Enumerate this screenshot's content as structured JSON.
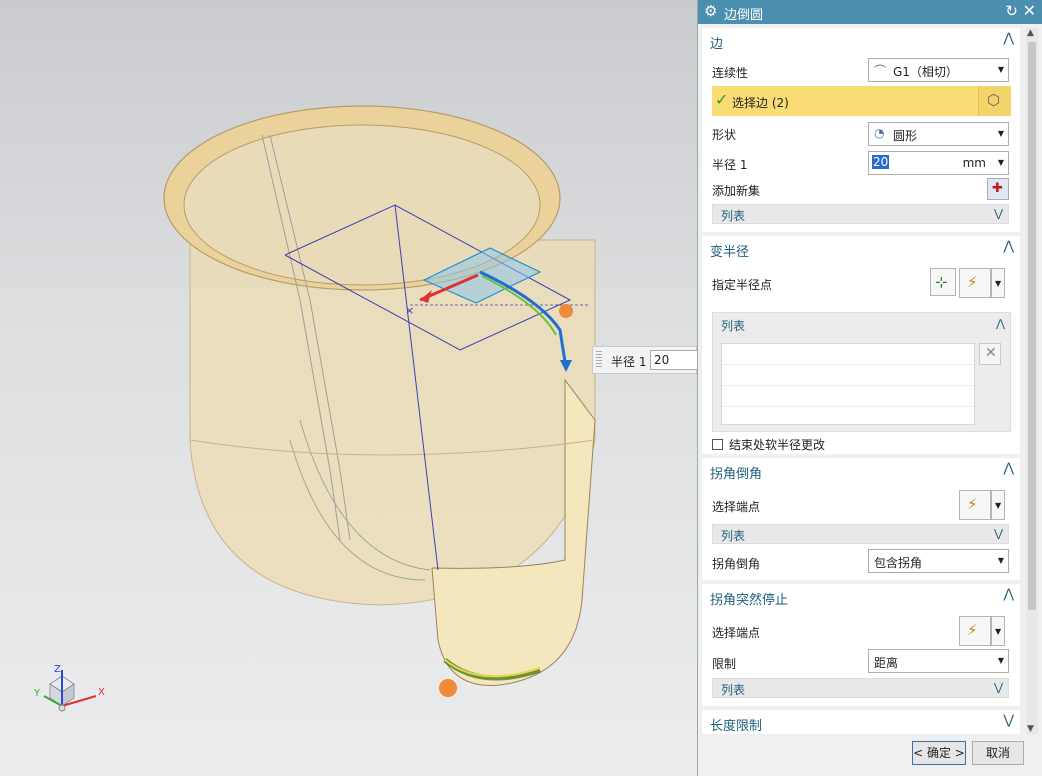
{
  "viewport": {
    "radius_tip": {
      "label": "半径 1",
      "value": "20"
    },
    "triad": {
      "x": "X",
      "y": "Y",
      "z": "Z"
    }
  },
  "dialog": {
    "title": "边倒圆",
    "icons": {
      "settings": "gear-icon",
      "reset": "reset-icon",
      "close": "close-icon"
    },
    "edge": {
      "header": "边",
      "continuity_label": "连续性",
      "continuity_value": "G1（相切）",
      "select_edge_text": "选择边 (2)",
      "shape_label": "形状",
      "shape_value": "圆形",
      "radius_label": "半径 1",
      "radius_value": "20",
      "radius_unit": "mm",
      "add_new_set_label": "添加新集",
      "list_label": "列表"
    },
    "variable_radius": {
      "header": "变半径",
      "point_label": "指定半径点",
      "list_label": "列表",
      "checkbox_label": "结束处软半径更改"
    },
    "corner_setback": {
      "header": "拐角倒角",
      "endpoint_label": "选择端点",
      "list_label": "列表",
      "corner_label": "拐角倒角",
      "corner_value": "包含拐角"
    },
    "corner_stop": {
      "header": "拐角突然停止",
      "endpoint_label": "选择端点",
      "limit_label": "限制",
      "limit_value": "距离",
      "list_label": "列表"
    },
    "length_limit": {
      "header": "长度限制"
    },
    "footer": {
      "ok": "< 确定 >",
      "cancel": "取消"
    }
  },
  "colors": {
    "title_bar": "#4a8fb0",
    "selection_highlight": "#f9dc73",
    "section_header": "#1f5e7a",
    "part_body": "#f1dfb6"
  }
}
